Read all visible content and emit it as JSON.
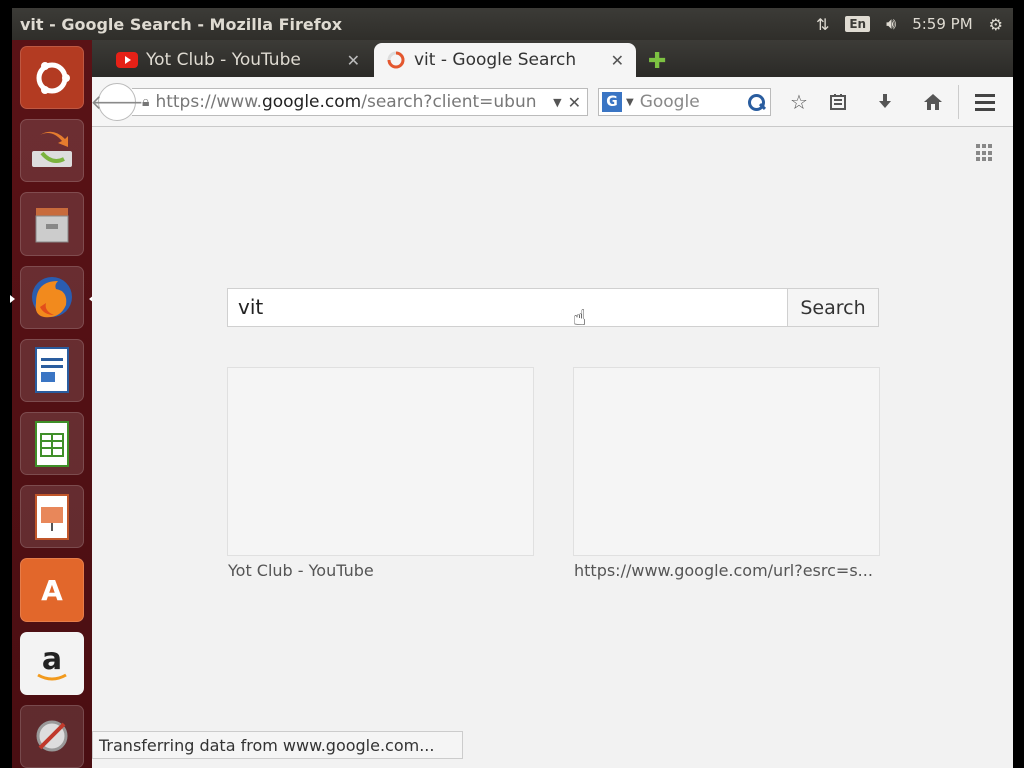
{
  "top_panel": {
    "window_title": "vit - Google Search - Mozilla Firefox",
    "lang": "En",
    "time": "5:59 PM"
  },
  "launcher": {
    "items": [
      "ubuntu-dash",
      "software-updater",
      "files",
      "firefox",
      "writer",
      "calc",
      "impress",
      "software-center",
      "amazon",
      "settings"
    ]
  },
  "tabs": [
    {
      "title": "Yot Club - YouTube",
      "favicon": "youtube-icon"
    },
    {
      "title": "vit - Google Search",
      "favicon": "loading-icon"
    }
  ],
  "urlbar": {
    "prefix": "https://www.",
    "domain": "google.com",
    "path": "/search?client=ubun"
  },
  "searchbar": {
    "placeholder": "Google",
    "engine": "G"
  },
  "page": {
    "query": "vit",
    "search_button": "Search",
    "thumbnails": [
      {
        "label": "Yot Club - YouTube"
      },
      {
        "label": "https://www.google.com/url?esrc=s..."
      }
    ]
  },
  "status_text": "Transferring data from www.google.com..."
}
